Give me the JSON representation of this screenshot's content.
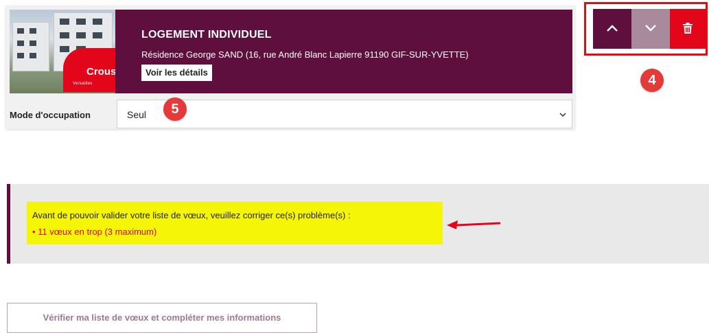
{
  "card": {
    "title": "LOGEMENT INDIVIDUEL",
    "address": "Résidence George SAND (16, rue André Blanc Lapierre 91190 GIF-SUR-YVETTE)",
    "details_label": "Voir les détails",
    "image_brand": "Crous",
    "image_brand_sub": "Versailles"
  },
  "occupation": {
    "label": "Mode d'occupation",
    "selected": "Seul"
  },
  "markers": {
    "actions": "4",
    "occupation": "5"
  },
  "actions": {
    "up_icon": "chevron-up-icon",
    "down_icon": "chevron-down-icon",
    "delete_icon": "trash-icon"
  },
  "alert": {
    "message": "Avant de pouvoir valider votre liste de vœux, veuillez corriger ce(s) problème(s) :",
    "errors": [
      "11 vœux en trop (3 maximum)"
    ]
  },
  "verify_button": "Vérifier ma liste de vœux et compléter mes informations",
  "colors": {
    "primary": "#5f0f3d",
    "primary_light": "#a98a9d",
    "danger": "#e3061a",
    "highlight": "#f5f507",
    "annotation": "#e43a3a"
  }
}
